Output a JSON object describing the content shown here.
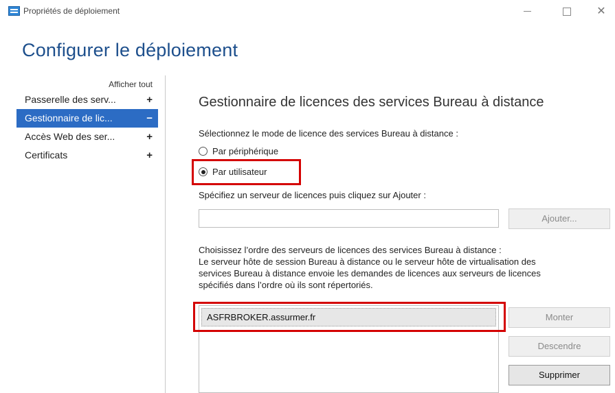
{
  "window": {
    "title": "Propriétés de déploiement",
    "icon": "server-icon",
    "controls": [
      "minimize",
      "maximize",
      "close"
    ]
  },
  "page": {
    "title": "Configurer le déploiement"
  },
  "sidebar": {
    "show_all": "Afficher tout",
    "items": [
      {
        "label": "Passerelle des serv...",
        "symbol": "+",
        "active": false
      },
      {
        "label": "Gestionnaire de lic...",
        "symbol": "−",
        "active": true
      },
      {
        "label": "Accès Web des ser...",
        "symbol": "+",
        "active": false
      },
      {
        "label": "Certificats",
        "symbol": "+",
        "active": false
      }
    ]
  },
  "main": {
    "section_title": "Gestionnaire de licences des services Bureau à distance",
    "mode_prompt": "Sélectionnez le mode de licence des services Bureau à distance :",
    "modes": [
      {
        "label": "Par périphérique",
        "checked": false
      },
      {
        "label": "Par utilisateur",
        "checked": true
      }
    ],
    "server_prompt": "Spécifiez un serveur de licences puis cliquez sur Ajouter :",
    "server_input": {
      "value": "",
      "placeholder": ""
    },
    "add_button": "Ajouter...",
    "order_text": [
      "Choisissez l’ordre des serveurs de licences des services Bureau à distance :",
      "Le serveur hôte de session Bureau à distance ou le serveur hôte de virtualisation des",
      "services Bureau à distance envoie les demandes de licences aux serveurs de licences",
      "spécifiés dans l’ordre où ils sont répertoriés."
    ],
    "servers": [
      "ASFRBROKER.assurmer.fr"
    ],
    "move_up_button": "Monter",
    "move_down_button": "Descendre",
    "delete_button": "Supprimer"
  },
  "colors": {
    "accent": "#2c6cc4",
    "title": "#1d4f8c",
    "highlight": "#d40000"
  }
}
